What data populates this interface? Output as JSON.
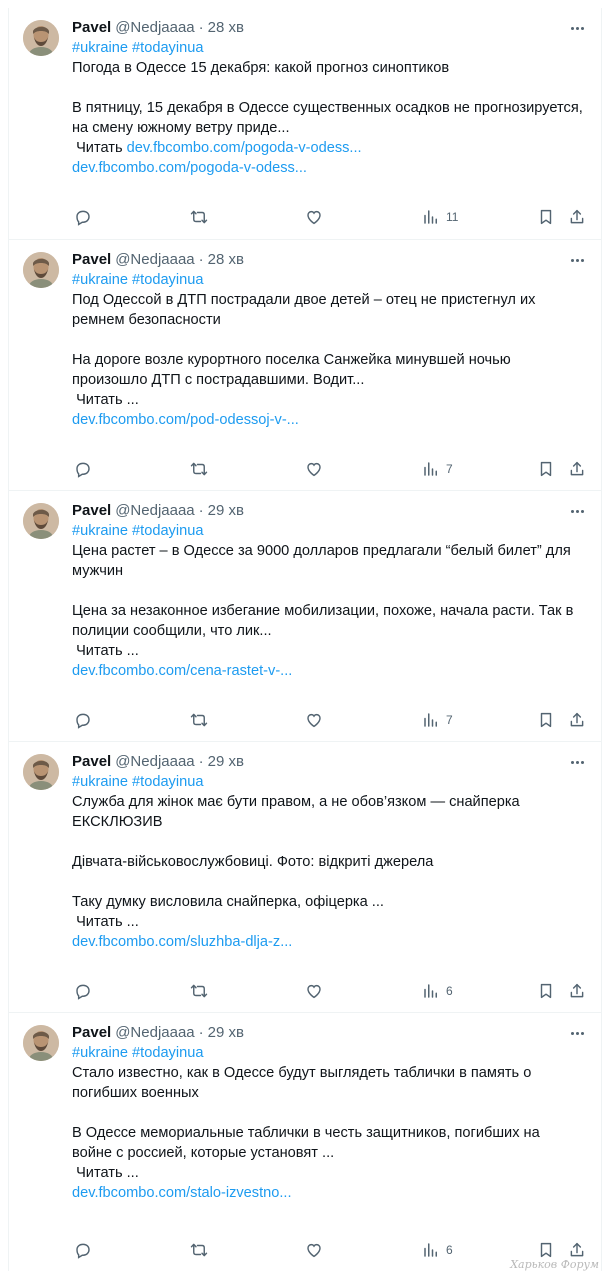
{
  "tweets": [
    {
      "name": "Pavel",
      "handle": "@Nedjaaaa",
      "time": "28 хв",
      "tags": "#ukraine #todayinua",
      "lines": [
        "Погода в Одессе 15 декабря: какой прогноз синоптиков",
        "",
        "В пятницу, 15 декабря в Одессе существенных осадков не прогнозируется,",
        "на смену южному ветру приде..."
      ],
      "read_prefix": "Читать ",
      "read_link": "dev.fbcombo.com/pogoda-v-odess...",
      "link": "dev.fbcombo.com/pogoda-v-odess...",
      "views": "11"
    },
    {
      "name": "Pavel",
      "handle": "@Nedjaaaa",
      "time": "28 хв",
      "tags": "#ukraine #todayinua",
      "lines": [
        "Под Одессой в ДТП пострадали двое детей – отец не пристегнул их",
        "ремнем безопасности",
        "",
        "На дороге возле курортного поселка Санжейка минувшей ночью",
        "произошло ДТП с пострадавшими. Водит..."
      ],
      "read_prefix": "Читать ...",
      "read_link": "",
      "link": "dev.fbcombo.com/pod-odessoj-v-...",
      "views": "7"
    },
    {
      "name": "Pavel",
      "handle": "@Nedjaaaa",
      "time": "29 хв",
      "tags": "#ukraine #todayinua",
      "lines": [
        "Цена растет – в Одессе за 9000 долларов предлагали “белый билет” для",
        "мужчин",
        "",
        "Цена за незаконное избегание мобилизации, похоже, начала расти. Так в",
        "полиции сообщили, что лик..."
      ],
      "read_prefix": "Читать ...",
      "read_link": "",
      "link": "dev.fbcombo.com/cena-rastet-v-...",
      "views": "7"
    },
    {
      "name": "Pavel",
      "handle": "@Nedjaaaa",
      "time": "29 хв",
      "tags": "#ukraine #todayinua",
      "lines": [
        "Служба для жінок має бути правом, а не обов’язком — снайперка",
        "ЕКСКЛЮЗИВ",
        "",
        "Дівчата-військовослужбовиці. Фото: відкриті джерела",
        "",
        "Таку думку висловила снайперка, офіцерка ..."
      ],
      "read_prefix": "Читать ...",
      "read_link": "",
      "link": "dev.fbcombo.com/sluzhba-dlja-z...",
      "views": "6"
    },
    {
      "name": "Pavel",
      "handle": "@Nedjaaaa",
      "time": "29 хв",
      "tags": "#ukraine #todayinua",
      "lines": [
        "Стало известно, как в Одессе будут выглядеть таблички в память о",
        "погибших военных",
        "",
        "В Одессе мемориальные таблички в честь защитников, погибших на",
        "войне с россией, которые установят ..."
      ],
      "read_prefix": "Читать ...",
      "read_link": "",
      "link": "dev.fbcombo.com/stalo-izvestno...",
      "views": "6"
    }
  ],
  "icons": [
    "reply-icon",
    "retweet-icon",
    "like-icon",
    "views-icon",
    "bookmark-icon",
    "share-icon"
  ],
  "watermark": "Харьков Форум",
  "colors": {
    "link": "#1d9bf0",
    "muted": "#536471",
    "text": "#0f1419",
    "divider": "#eff3f4"
  }
}
